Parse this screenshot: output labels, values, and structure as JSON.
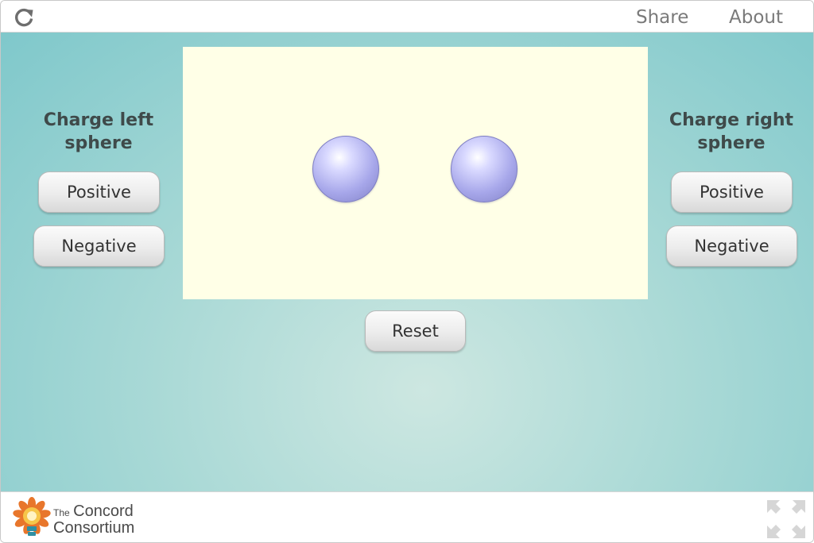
{
  "topbar": {
    "reload_icon": "reload-icon",
    "share_label": "Share",
    "about_label": "About"
  },
  "left_panel": {
    "title_line1": "Charge left",
    "title_line2": "sphere",
    "positive_label": "Positive",
    "negative_label": "Negative"
  },
  "right_panel": {
    "title_line1": "Charge right",
    "title_line2": "sphere",
    "positive_label": "Positive",
    "negative_label": "Negative"
  },
  "simulation": {
    "spheres": [
      "left-sphere",
      "right-sphere"
    ]
  },
  "reset_label": "Reset",
  "footer": {
    "logo_small": "The",
    "logo_line1": "Concord",
    "logo_line2": "Consortium",
    "fullscreen_icon": "fullscreen-icon"
  },
  "colors": {
    "stage_center": "#cde7e1",
    "stage_edge": "#7fc8cb",
    "sim_background": "#ffffe7",
    "sphere": "#a7a7ea",
    "logo_orange": "#e8762b"
  }
}
